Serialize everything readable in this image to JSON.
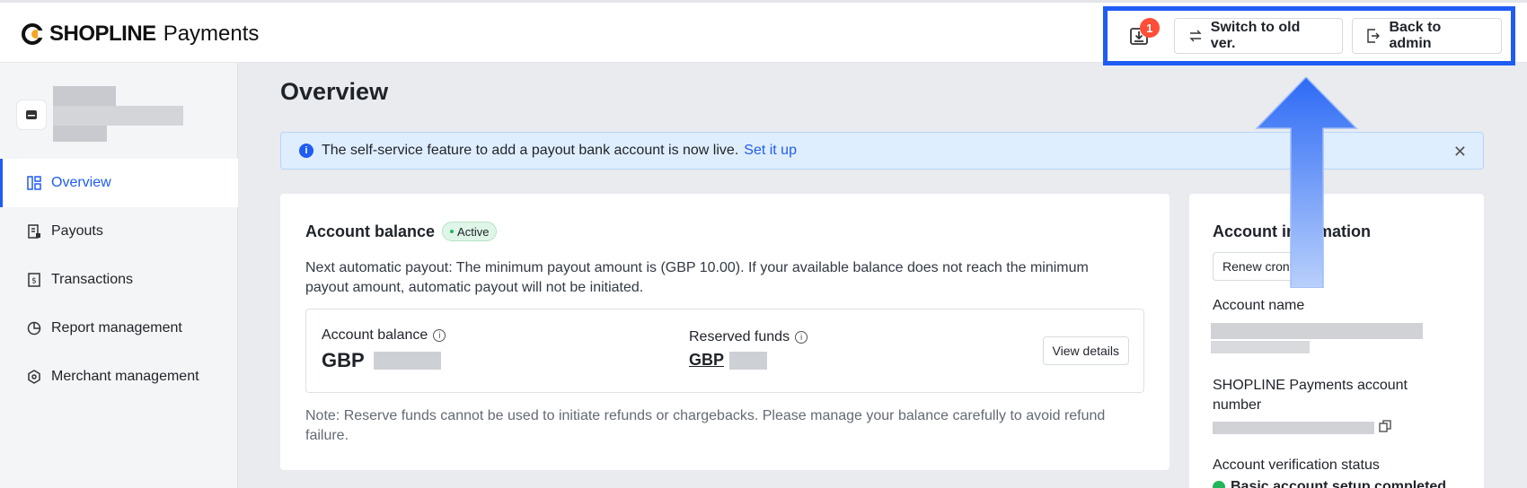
{
  "header": {
    "brand": "SHOPLINE",
    "product": "Payments",
    "notification_count": "1",
    "switch_label": "Switch to old ver.",
    "back_label": "Back to admin"
  },
  "sidebar": {
    "items": [
      {
        "label": "Overview",
        "icon": "overview-icon",
        "active": true
      },
      {
        "label": "Payouts",
        "icon": "payouts-icon"
      },
      {
        "label": "Transactions",
        "icon": "transactions-icon"
      },
      {
        "label": "Report management",
        "icon": "report-icon"
      },
      {
        "label": "Merchant management",
        "icon": "merchant-icon"
      }
    ]
  },
  "main": {
    "title": "Overview",
    "banner": {
      "text": "The self-service feature to add a payout bank account is now live.",
      "link": "Set it up"
    },
    "balance_card": {
      "title": "Account balance",
      "status": "Active",
      "payout_text": "Next automatic payout: The minimum payout amount is (GBP 10.00). If your available balance does not reach the minimum payout amount, automatic payout will not be initiated.",
      "balance_label": "Account balance",
      "balance_currency": "GBP",
      "reserved_label": "Reserved funds",
      "reserved_currency": "GBP",
      "view_details": "View details",
      "note": "Note: Reserve funds cannot be used to initiate refunds or chargebacks. Please manage your balance carefully to avoid refund failure."
    },
    "info_card": {
      "title": "Account information",
      "renew_label": "Renew cronts",
      "account_name_label": "Account name",
      "account_number_label": "SHOPLINE Payments account number",
      "verification_label": "Account verification status",
      "verification_value": "Basic account setup completed"
    }
  },
  "colors": {
    "accent": "#1f5cf4",
    "badge": "#ff4d38",
    "active_green": "#23b55c"
  }
}
